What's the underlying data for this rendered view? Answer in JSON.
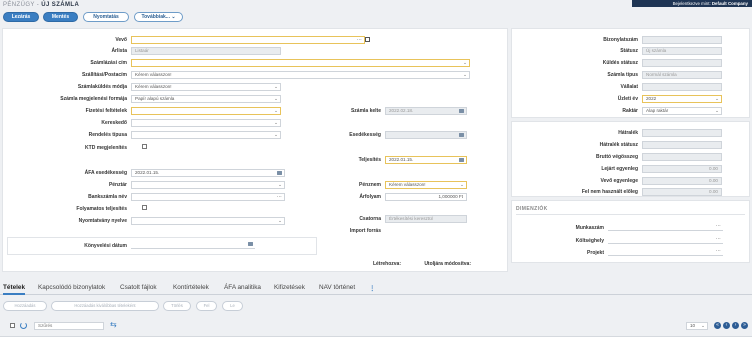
{
  "breadcrumb": {
    "section": "PÉNZÜGY",
    "separator": " - ",
    "page": "ÚJ SZÁMLA"
  },
  "login": {
    "prefix": "Bejelentkezve mint: ",
    "company": "Default Company"
  },
  "toolbar": {
    "close_label": "Lezárás",
    "save_label": "Mentés",
    "print_label": "Nyomtatás",
    "more_label": "Továbbiak..."
  },
  "form": {
    "vevo": {
      "label": "Vevő",
      "value": "",
      "dots": "..."
    },
    "arlista": {
      "label": "Árlista",
      "value": "Listaár"
    },
    "szamlazasi_cim": {
      "label": "Számlázási cím",
      "value": ""
    },
    "szallitasi_cim": {
      "label": "Szállítási/Postacím",
      "value": "Kérem válasszon!"
    },
    "szamlakuldes": {
      "label": "Számlaküldés módja",
      "value": "Kérem válasszon!"
    },
    "megjelenes": {
      "label": "Számla megjelenési formája",
      "value": "Papír alapú számla"
    },
    "fizetesi": {
      "label": "Fizetési feltételek",
      "value": ""
    },
    "kereskedo": {
      "label": "Kereskedő",
      "value": ""
    },
    "rendeles_tipusa": {
      "label": "Rendelés típusa",
      "value": ""
    },
    "ktd": {
      "label": "KTD megjelenítés"
    },
    "afa_esedekesseg": {
      "label": "ÁFA esedékesség",
      "value": "2022.01.15."
    },
    "penztar": {
      "label": "Pénztár",
      "value": ""
    },
    "bankszamla": {
      "label": "Bankszámla név",
      "value": "",
      "dots": "..."
    },
    "folyamatos": {
      "label": "Folyamatos teljesítés"
    },
    "nyomtatvany": {
      "label": "Nyomtatvány nyelve",
      "value": ""
    },
    "konyvelesi": {
      "label": "Könyvelési dátum",
      "value": ""
    },
    "szamla_kelte": {
      "label": "Számla kelte",
      "value": "2022.02.18."
    },
    "esedekesseg": {
      "label": "Esedékesség",
      "value": ""
    },
    "teljesites": {
      "label": "Teljesítés",
      "value": "2022.01.15."
    },
    "penznem": {
      "label": "Pénznem",
      "value": "Kérem válasszon!"
    },
    "arfolyam": {
      "label": "Árfolyam",
      "value": "1,000000 Ft"
    },
    "csatorna": {
      "label": "Csatorna",
      "value": "Értékesítési keresztül"
    },
    "import_forras": {
      "label": "Import forrás"
    },
    "letrehozva": {
      "label": "Létrehozva:"
    },
    "utoljara": {
      "label": "Utoljára módosítva:"
    }
  },
  "info": {
    "bizonylatszam": {
      "label": "Bizonylatszám",
      "value": ""
    },
    "statusz": {
      "label": "Státusz",
      "value": "Új számla"
    },
    "kuldes_statusz": {
      "label": "Küldés státusz",
      "value": ""
    },
    "szamla_tipus": {
      "label": "Számla típus",
      "value": "Normál számla"
    },
    "vallalat": {
      "label": "Vállalat",
      "value": ""
    },
    "uzleti_ev": {
      "label": "Üzleti év",
      "value": "2022"
    },
    "raktar": {
      "label": "Raktár",
      "value": "Alap raktár"
    }
  },
  "balances": {
    "hatralek": {
      "label": "Hátralék",
      "value": ""
    },
    "hatralek_statusz": {
      "label": "Hátralék státusz",
      "value": ""
    },
    "brutto": {
      "label": "Bruttó végösszeg",
      "value": ""
    },
    "lejart": {
      "label": "Lejárt egyenleg",
      "value": "0.00"
    },
    "vevo_egyenlege": {
      "label": "Vevő egyenlege",
      "value": "0.00"
    },
    "fel_nem": {
      "label": "Fel nem használt előleg",
      "value": "0.00"
    }
  },
  "dimensions": {
    "title": "DIMENZIÓK",
    "munkaszam": {
      "label": "Munkaszám",
      "dots": "..."
    },
    "koltseghely": {
      "label": "Költséghely",
      "dots": "..."
    },
    "projekt": {
      "label": "Projekt",
      "dots": "..."
    }
  },
  "tabs": [
    "Tételek",
    "Kapcsolódó bizonylatok",
    "Csatolt fájlok",
    "Kontírtételek",
    "ÁFA analitika",
    "Kifizetések",
    "NAV történet"
  ],
  "tabs_more": "⋮",
  "subbuttons": [
    "Hozzáadás",
    "Hozzáadás kiválóbbas tételeként",
    "Törlés",
    "Fel",
    "Le"
  ],
  "table": {
    "filter_placeholder": "Szűrés",
    "page_size": "10"
  },
  "colors": {
    "primary": "#3a7ec2",
    "required_border": "#e8c35a",
    "login_bg": "#1f3554"
  },
  "icons": [
    "edit-icon",
    "calendar-icon",
    "chevron-down-icon",
    "refresh-icon",
    "checkbox-icon",
    "swap-icon",
    "first-page-icon",
    "prev-page-icon",
    "next-page-icon",
    "last-page-icon"
  ]
}
